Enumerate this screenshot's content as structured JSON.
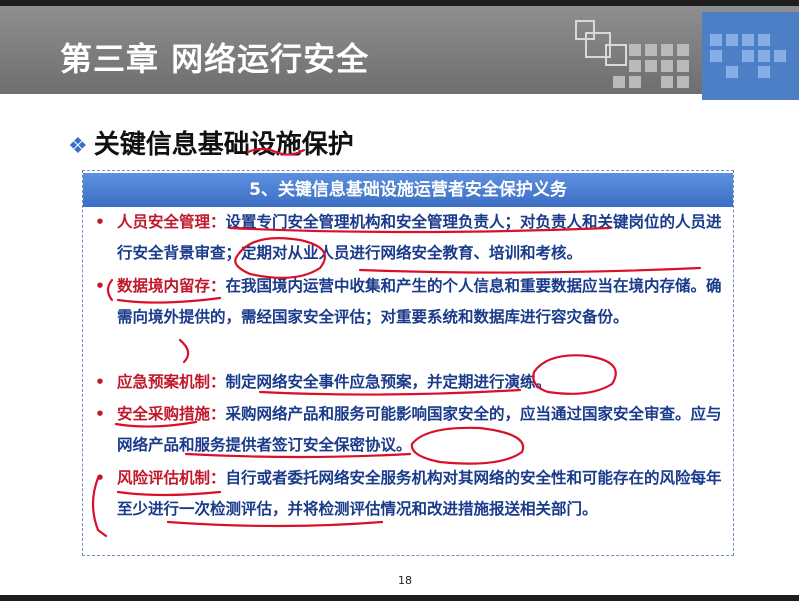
{
  "slide": {
    "title": "第三章  网络运行安全",
    "subtitle": "关键信息基础设施保护",
    "page_number": "18"
  },
  "panel": {
    "heading": "5、关键信息基础设施运营者安全保护义务",
    "items": [
      {
        "key": "人员安全管理：",
        "text": "设置专门安全管理机构和安全管理负责人；对负责人和关键岗位的人员进行安全背景审查；定期对从业人员进行网络安全教育、培训和考核。"
      },
      {
        "key": "数据境内留存：",
        "text": "在我国境内运营中收集和产生的个人信息和重要数据应当在境内存储。确需向境外提供的，需经国家安全评估；对重要系统和数据库进行容灾备份。"
      },
      {
        "key": "应急预案机制：",
        "text": "制定网络安全事件应急预案，并定期进行演练。"
      },
      {
        "key": "安全采购措施：",
        "text": "采购网络产品和服务可能影响国家安全的，应当通过国家安全审查。应与网络产品和服务提供者签订安全保密协议。"
      },
      {
        "key": "风险评估机制：",
        "text": "自行或者委托网络安全服务机构对其网络的安全性和可能存在的风险每年至少进行一次检测评估，并将检测评估情况和改进措施报送相关部门。"
      }
    ]
  },
  "icons": {
    "subtitle_bullet": "diamond-cluster-icon",
    "item_bullet": "red-dot-icon"
  },
  "colors": {
    "header_bg": "#7f7f7f",
    "accent_blue": "#3c6fc4",
    "key_red": "#c0182a",
    "body_blue": "#1a3a8a",
    "annotation_red": "#d8102a"
  }
}
